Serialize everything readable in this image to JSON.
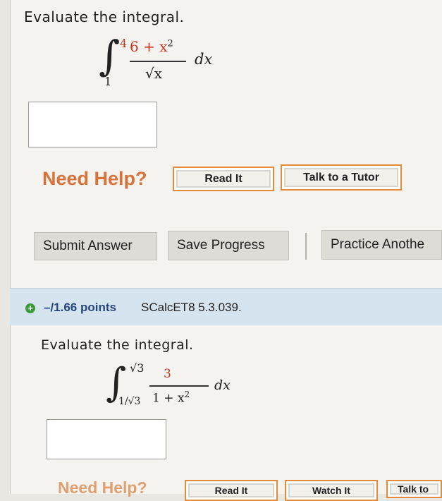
{
  "q1": {
    "title": "Evaluate the integral.",
    "upper": "4",
    "lower": "1",
    "numerator": "6 + x",
    "num_exp": "2",
    "denominator": "√x",
    "dx": "dx",
    "need_help": "Need Help?",
    "read_it": "Read It",
    "talk_tutor": "Talk to a Tutor"
  },
  "actions": {
    "submit": "Submit Answer",
    "save": "Save Progress",
    "practice": "Practice Anothe"
  },
  "q2_header": {
    "points": "–/1.66 points",
    "ref": "SCalcET8 5.3.039."
  },
  "q2": {
    "title": "Evaluate the integral.",
    "upper": "√3",
    "lower": "1/√3",
    "numerator": "3",
    "denominator": "1 + x",
    "den_exp": "2",
    "dx": "dx",
    "need_help": "Need Help?",
    "read_it": "Read It",
    "watch_it": "Watch It",
    "talk_to": "Talk to"
  }
}
